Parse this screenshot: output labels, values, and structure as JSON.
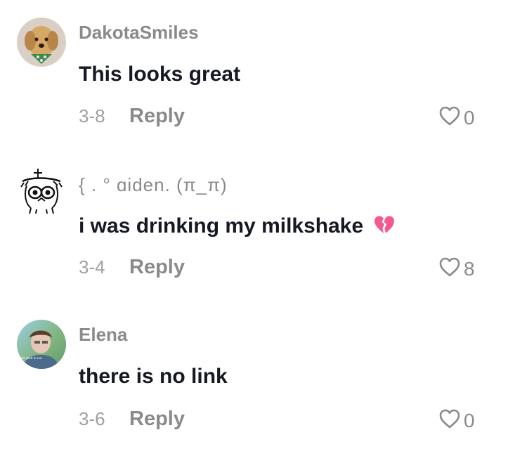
{
  "comments": [
    {
      "username": "DakotaSmiles",
      "text": "This looks great",
      "date": "3-8",
      "reply_label": "Reply",
      "likes": "0"
    },
    {
      "username": "{ . ° ɑiden. (π_π)",
      "text": "i was drinking my milkshake",
      "date": "3-4",
      "reply_label": "Reply",
      "likes": "8"
    },
    {
      "username": "Elena",
      "text": "there is no link",
      "date": "3-6",
      "reply_label": "Reply",
      "likes": "0"
    }
  ],
  "colors": {
    "username": "#8a8a8a",
    "text": "#161823",
    "date": "#a0a0a0",
    "emoji_heart": "#f55a8f"
  }
}
